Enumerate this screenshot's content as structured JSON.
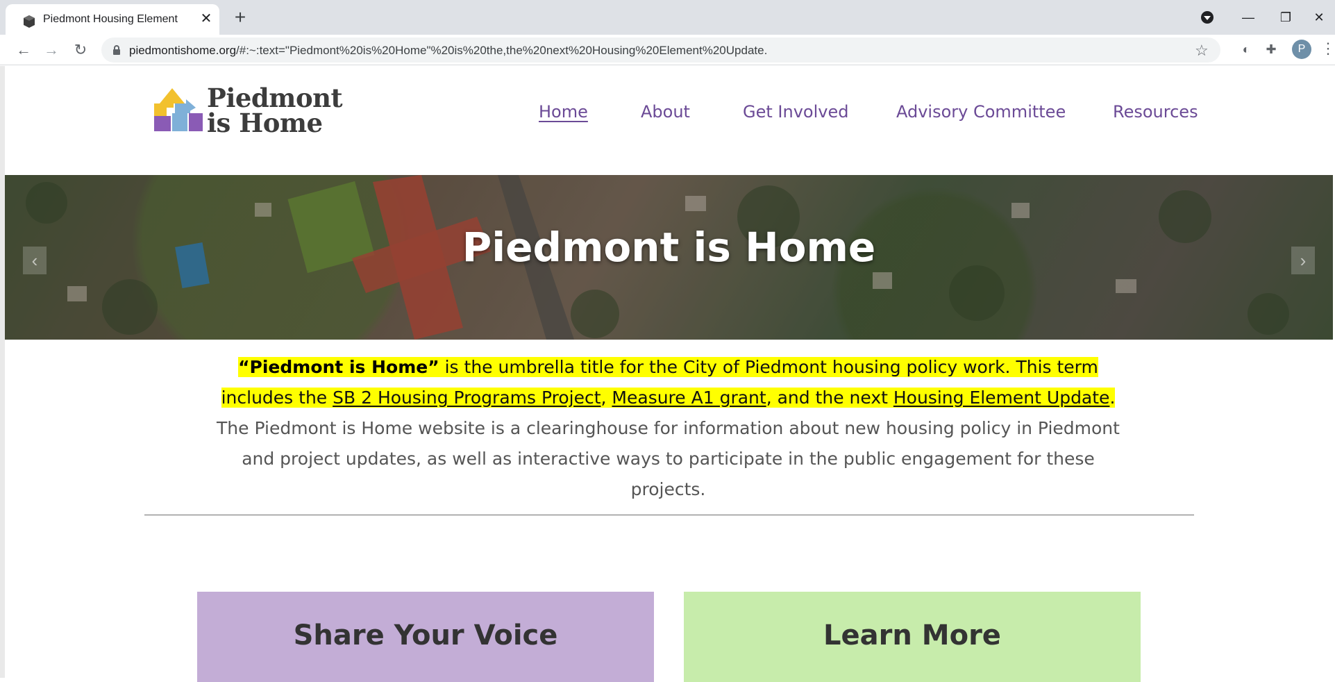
{
  "browser": {
    "tab_title": "Piedmont Housing Element",
    "new_tab_symbol": "+",
    "close_symbol": "✕",
    "url_host": "piedmontishome.org",
    "url_rest": "/#:~:text=\"Piedmont%20is%20Home\"%20is%20the,the%20next%20Housing%20Element%20Update.",
    "profile_initial": "P",
    "window_controls": {
      "minimize": "—",
      "restore": "❐",
      "close": "✕"
    }
  },
  "site": {
    "logo_line1": "Piedmont",
    "logo_line2": "is Home",
    "nav": [
      {
        "label": "Home",
        "active": true
      },
      {
        "label": "About"
      },
      {
        "label": "Get Involved"
      },
      {
        "label": "Advisory Committee"
      },
      {
        "label": "Resources"
      }
    ],
    "nav_color": "#6b4a96"
  },
  "hero": {
    "title": "Piedmont is Home",
    "prev_arrow": "‹",
    "next_arrow": "›"
  },
  "intro": {
    "quote_title": "“Piedmont is Home”",
    "text1": " is the umbrella title for the City of Piedmont housing policy work. This term includes the ",
    "link1": "SB 2 Housing Programs Project",
    "sep1": ", ",
    "link2": "Measure A1 grant",
    "text2": ", and the next ",
    "link3": "Housing Element Update",
    "period": ".",
    "text3": " The Piedmont is Home website is a clearinghouse for information about new housing policy in Piedmont and project updates, as well as interactive ways to participate in the public engagement for these projects.",
    "highlight_color": "#ffff00"
  },
  "cards": [
    {
      "title": "Share Your Voice",
      "color": "#c3add6"
    },
    {
      "title": "Learn More",
      "color": "#c7ecab"
    }
  ]
}
